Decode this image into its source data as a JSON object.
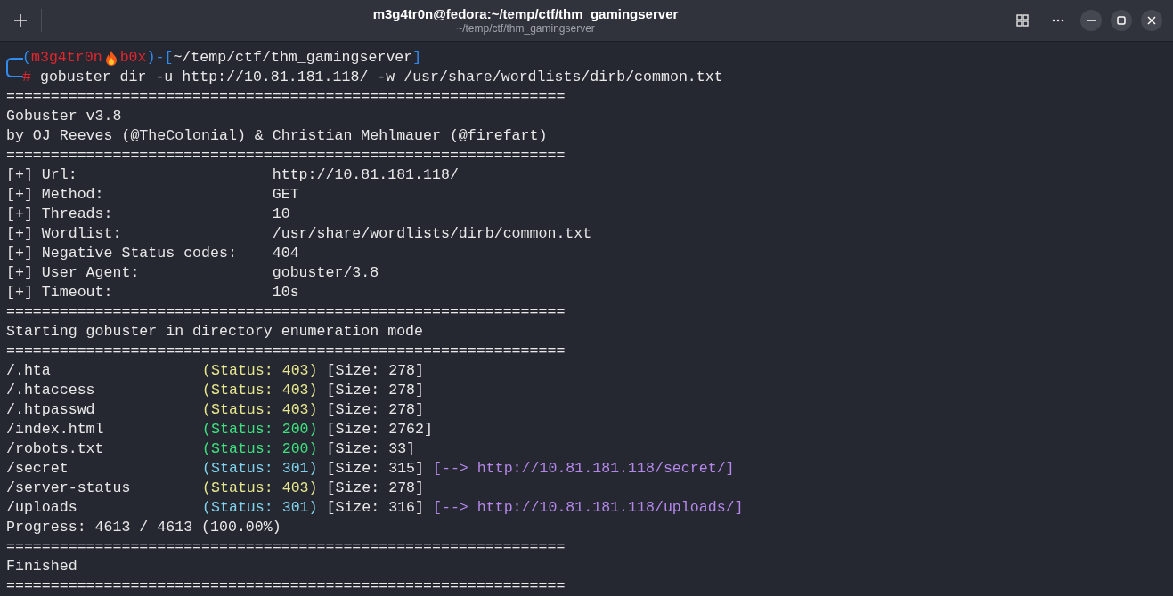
{
  "window": {
    "title": "m3g4tr0n@fedora:~/temp/ctf/thm_gamingserver",
    "subtitle": "~/temp/ctf/thm_gamingserver"
  },
  "prompt": {
    "user": "m3g4tr0n",
    "host": "b0x",
    "path": "~/temp/ctf/thm_gamingserver",
    "symbol": "#",
    "open": "(",
    "middle": ")-[",
    "close": "]",
    "command": "gobuster dir -u http://10.81.181.118/ -w /usr/share/wordlists/dirb/common.txt"
  },
  "output": [
    {
      "kind": "text",
      "text": "==============================================================="
    },
    {
      "kind": "text",
      "text": "Gobuster v3.8"
    },
    {
      "kind": "text",
      "text": "by OJ Reeves (@TheColonial) & Christian Mehlmauer (@firefart)"
    },
    {
      "kind": "text",
      "text": "==============================================================="
    },
    {
      "kind": "setting",
      "label": "[+] Url:",
      "value": "http://10.81.181.118/"
    },
    {
      "kind": "setting",
      "label": "[+] Method:",
      "value": "GET"
    },
    {
      "kind": "setting",
      "label": "[+] Threads:",
      "value": "10"
    },
    {
      "kind": "setting",
      "label": "[+] Wordlist:",
      "value": "/usr/share/wordlists/dirb/common.txt"
    },
    {
      "kind": "setting",
      "label": "[+] Negative Status codes:",
      "value": "404"
    },
    {
      "kind": "setting",
      "label": "[+] User Agent:",
      "value": "gobuster/3.8"
    },
    {
      "kind": "setting",
      "label": "[+] Timeout:",
      "value": "10s"
    },
    {
      "kind": "text",
      "text": "==============================================================="
    },
    {
      "kind": "text",
      "text": "Starting gobuster in directory enumeration mode"
    },
    {
      "kind": "text",
      "text": "==============================================================="
    },
    {
      "kind": "result",
      "path": "/.hta",
      "status": "(Status: 403)",
      "color": "#e6e68c",
      "size": "[Size: 278]"
    },
    {
      "kind": "result",
      "path": "/.htaccess",
      "status": "(Status: 403)",
      "color": "#e6e68c",
      "size": "[Size: 278]"
    },
    {
      "kind": "result",
      "path": "/.htpasswd",
      "status": "(Status: 403)",
      "color": "#e6e68c",
      "size": "[Size: 278]"
    },
    {
      "kind": "result",
      "path": "/index.html",
      "status": "(Status: 200)",
      "color": "#3ee07f",
      "size": "[Size: 2762]"
    },
    {
      "kind": "result",
      "path": "/robots.txt",
      "status": "(Status: 200)",
      "color": "#3ee07f",
      "size": "[Size: 33]"
    },
    {
      "kind": "result",
      "path": "/secret",
      "status": "(Status: 301)",
      "color": "#80d4ee",
      "size": "[Size: 315]",
      "redirect": "[--> http://10.81.181.118/secret/]"
    },
    {
      "kind": "result",
      "path": "/server-status",
      "status": "(Status: 403)",
      "color": "#e6e68c",
      "size": "[Size: 278]"
    },
    {
      "kind": "result",
      "path": "/uploads",
      "status": "(Status: 301)",
      "color": "#80d4ee",
      "size": "[Size: 316]",
      "redirect": "[--> http://10.81.181.118/uploads/]"
    },
    {
      "kind": "text",
      "text": "Progress: 4613 / 4613 (100.00%)"
    },
    {
      "kind": "text",
      "text": "==============================================================="
    },
    {
      "kind": "text",
      "text": "Finished"
    },
    {
      "kind": "text",
      "text": "==============================================================="
    }
  ]
}
